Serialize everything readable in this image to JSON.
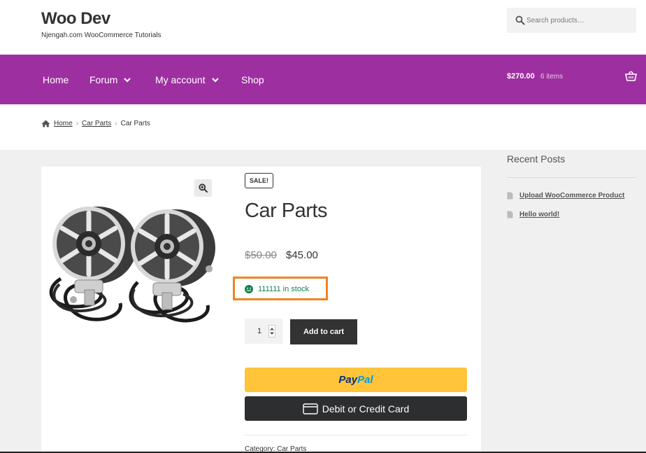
{
  "header": {
    "site_title": "Woo Dev",
    "site_description": "Njengah.com WooCommerce Tutorials",
    "search_placeholder": "Search products…"
  },
  "nav": {
    "items": [
      {
        "label": "Home",
        "has_dropdown": false
      },
      {
        "label": "Forum",
        "has_dropdown": true
      },
      {
        "label": "My account",
        "has_dropdown": true
      },
      {
        "label": "Shop",
        "has_dropdown": false
      }
    ],
    "cart_total": "$270.00",
    "cart_count": "6 items"
  },
  "breadcrumb": {
    "items": [
      "Home",
      "Car Parts",
      "Car Parts"
    ],
    "separator": "›"
  },
  "product": {
    "sale_badge": "SALE!",
    "title": "Car Parts",
    "regular_price": "$50.00",
    "sale_price": "$45.00",
    "stock_text": "111111 in stock",
    "quantity": "1",
    "add_to_cart_label": "Add to cart",
    "paypal_pay": "Pay",
    "paypal_pal": "Pal",
    "debit_label": "Debit or Credit Card",
    "category_label": "Category:",
    "category_value": "Car Parts"
  },
  "sidebar": {
    "recent_posts_title": "Recent Posts",
    "posts": [
      "Upload WooCommerce Product",
      "Hello world!"
    ]
  },
  "colors": {
    "brand_purple": "#9e2fa1",
    "stock_green": "#0f834d",
    "highlight_orange": "#f58220",
    "paypal_yellow": "#ffc439",
    "dark_button": "#333333"
  }
}
